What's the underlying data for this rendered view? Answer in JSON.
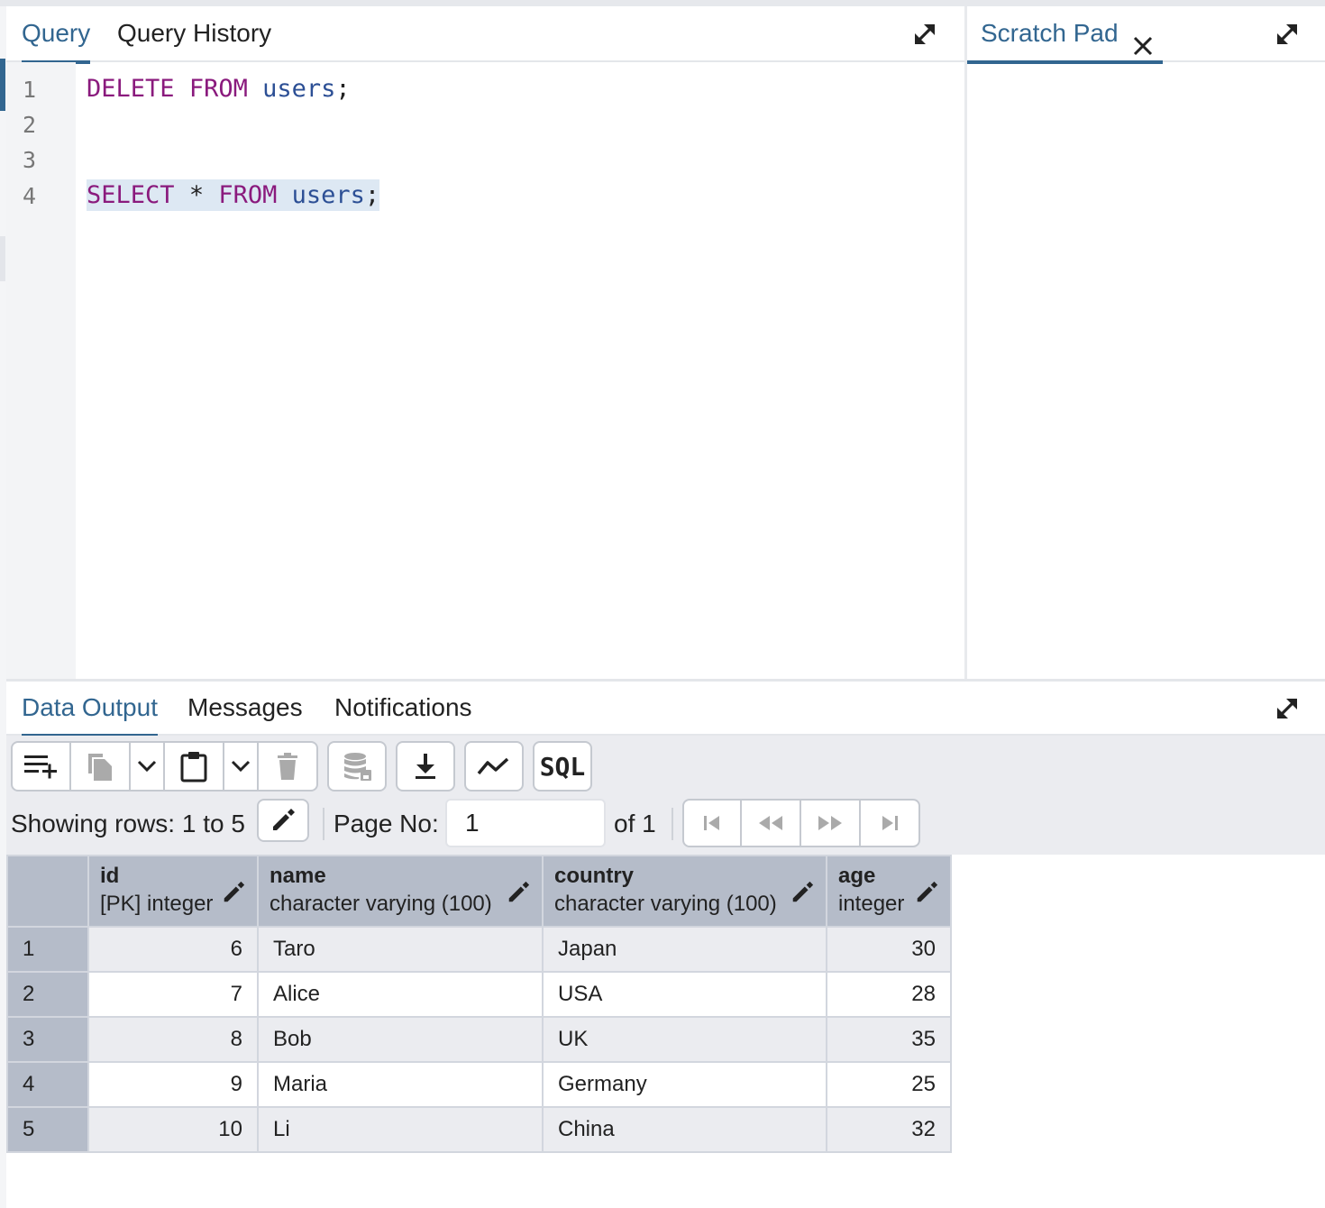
{
  "query_tabs": [
    "Query",
    "Query History"
  ],
  "scratch_tab": "Scratch Pad",
  "editor": {
    "line_numbers": [
      "1",
      "2",
      "3",
      "4"
    ],
    "line1": {
      "kw1": "DELETE",
      "kw2": "FROM",
      "ident": "users",
      "end": ";"
    },
    "line4": {
      "kw1": "SELECT",
      "star": "*",
      "kw2": "FROM",
      "ident": "users",
      "end": ";"
    }
  },
  "output_tabs": [
    "Data Output",
    "Messages",
    "Notifications"
  ],
  "toolbar": {
    "sql_label": "SQL"
  },
  "pagination": {
    "showing_label": "Showing rows: 1 to 5",
    "page_label": "Page No:",
    "page_value": "1",
    "of_label": "of 1"
  },
  "columns": [
    {
      "name": "id",
      "type": "[PK] integer"
    },
    {
      "name": "name",
      "type": "character varying (100)"
    },
    {
      "name": "country",
      "type": "character varying (100)"
    },
    {
      "name": "age",
      "type": "integer"
    }
  ],
  "rows": [
    {
      "n": "1",
      "id": "6",
      "name": "Taro",
      "country": "Japan",
      "age": "30"
    },
    {
      "n": "2",
      "id": "7",
      "name": "Alice",
      "country": "USA",
      "age": "28"
    },
    {
      "n": "3",
      "id": "8",
      "name": "Bob",
      "country": "UK",
      "age": "35"
    },
    {
      "n": "4",
      "id": "9",
      "name": "Maria",
      "country": "Germany",
      "age": "25"
    },
    {
      "n": "5",
      "id": "10",
      "name": "Li",
      "country": "China",
      "age": "32"
    }
  ],
  "colors": {
    "accent": "#326690",
    "keyword": "#8a1a7d",
    "identifier": "#2c4f95",
    "header_bg": "#b5bcc9",
    "toolbar_bg": "#ebecf0"
  },
  "icons": [
    "expand-icon",
    "close-icon",
    "add-row-icon",
    "copy-icon",
    "chevron-down-icon",
    "paste-icon",
    "delete-icon",
    "save-data-icon",
    "download-icon",
    "graph-icon",
    "edit-pencil-icon",
    "first-page-icon",
    "previous-page-icon",
    "next-page-icon",
    "last-page-icon"
  ]
}
